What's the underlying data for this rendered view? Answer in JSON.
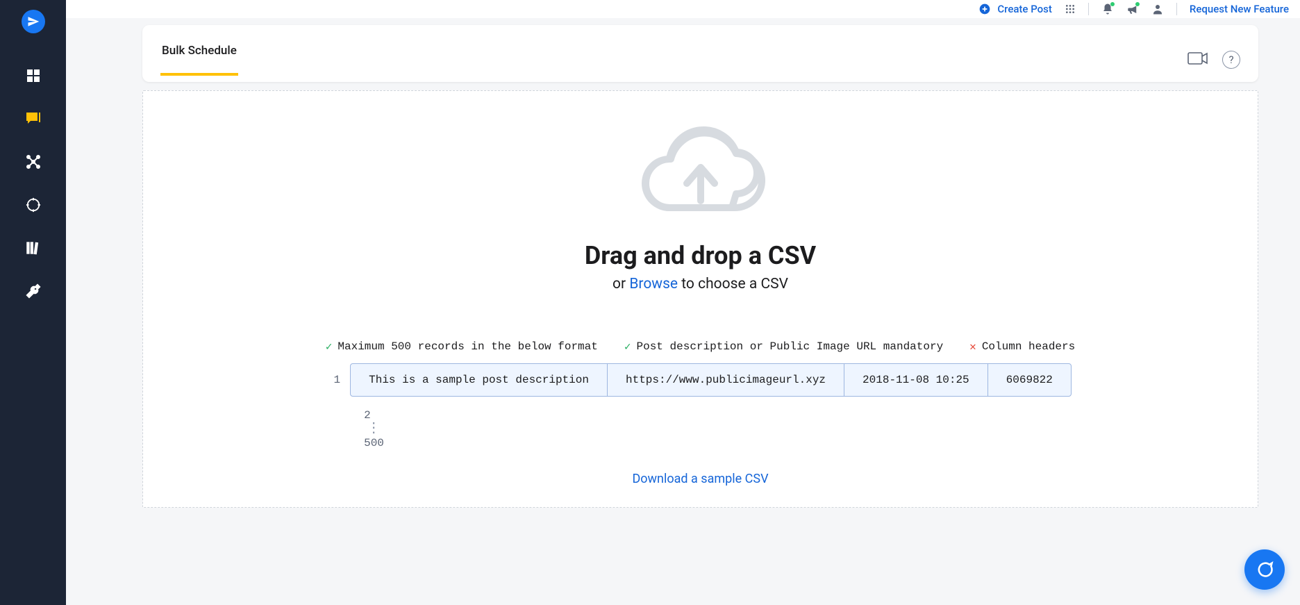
{
  "topbar": {
    "create_post": "Create Post",
    "request_feature": "Request New Feature"
  },
  "tabs": {
    "bulk_schedule": "Bulk Schedule"
  },
  "dropzone": {
    "headline": "Drag and drop a CSV",
    "sub_prefix": "or ",
    "sub_link": "Browse",
    "sub_suffix": " to choose a CSV"
  },
  "rules": {
    "max_records": "Maximum 500 records in the below format",
    "mandatory": "Post description or Public Image URL mandatory",
    "column_headers": "Column headers"
  },
  "sample": {
    "row": "1",
    "description": "This is a sample post description",
    "url": "https://www.publicimageurl.xyz",
    "datetime": "2018-11-08 10:25",
    "id": "6069822"
  },
  "rows": {
    "two": "2",
    "max": "500"
  },
  "download": "Download a sample CSV"
}
